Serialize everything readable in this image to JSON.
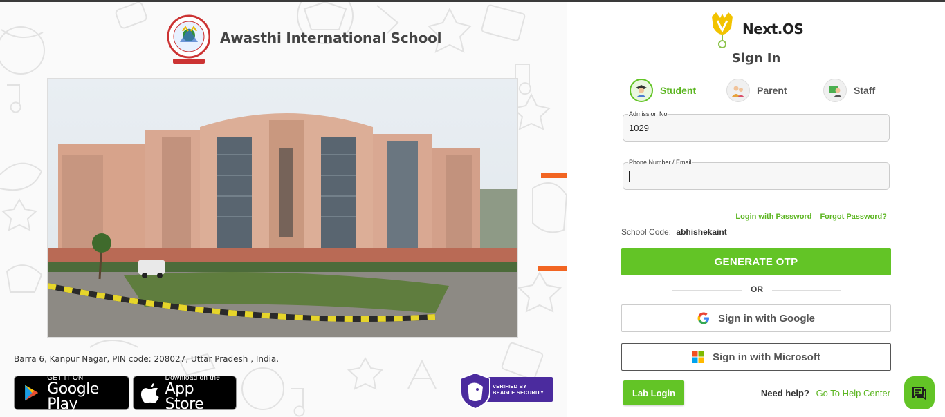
{
  "school": {
    "name": "Awasthi International School",
    "address": "Barra 6, Kanpur Nagar, PIN code: 208027, Uttar Pradesh , India."
  },
  "stores": {
    "google_play_small": "GET IT ON",
    "google_play_big": "Google Play",
    "app_store_small": "Download on the",
    "app_store_big": "App Store"
  },
  "badge": {
    "line1": "VERIFIED BY",
    "line2": "BEAGLE SECURITY"
  },
  "brand": {
    "name": "Next.OS"
  },
  "signin": {
    "title": "Sign In",
    "roles": [
      {
        "label": "Student",
        "active": true
      },
      {
        "label": "Parent",
        "active": false
      },
      {
        "label": "Staff",
        "active": false
      }
    ],
    "admission": {
      "label": "Admission No",
      "value": "1029"
    },
    "phone": {
      "label": "Phone Number / Email",
      "value": ""
    },
    "login_with_password": "Login with Password",
    "forgot_password": "Forgot Password?",
    "school_code_label": "School Code:",
    "school_code_value": "abhishekaint",
    "generate_otp": "GENERATE OTP",
    "or": "OR",
    "google": "Sign in with Google",
    "microsoft": "Sign in with Microsoft",
    "lab_login": "Lab Login",
    "need_help": "Need help?",
    "help_center": "Go To Help Center"
  },
  "colors": {
    "accent": "#63c426",
    "arrow": "#f26522",
    "badge": "#4b2b9e"
  },
  "icons": [
    "chat-icon",
    "google-icon",
    "microsoft-icon",
    "play-store-icon",
    "apple-icon"
  ]
}
